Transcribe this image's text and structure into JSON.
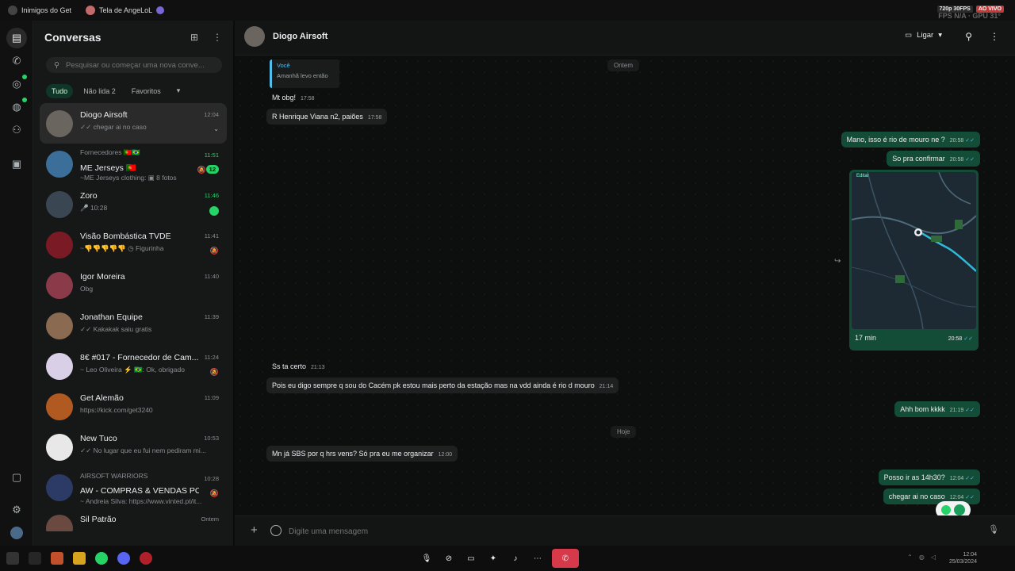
{
  "topbar": {
    "stream1": "Inimigos do Get",
    "stream2": "Tela de AngeLoL",
    "quality": "720p 30FPS",
    "live": "AO VIVO",
    "fps": "FPS N/A · GPU 31°"
  },
  "sidebar": {
    "title": "Conversas",
    "search_placeholder": "Pesquisar ou começar uma nova conve...",
    "filters": {
      "all": "Tudo",
      "unread": "Não lida",
      "unread_count": "2",
      "favorites": "Favoritos"
    },
    "chats": [
      {
        "name": "Diogo Airsoft",
        "preview": "✓✓ chegar ai no caso",
        "time": "12:04",
        "color": "#6b6560"
      },
      {
        "group": "Fornecedores 🇵🇹🇧🇷",
        "name": "ME Jerseys 🇵🇹",
        "preview": "~ME Jerseys clothing: ▣ 8 fotos",
        "time": "11:51",
        "unread": "12",
        "color": "#3c6e9a"
      },
      {
        "name": "Zoro",
        "preview": "🎤 10:28",
        "time": "11:46",
        "color": "#3a4752"
      },
      {
        "name": "Visão Bombástica TVDE",
        "preview": "~👎👎👎👎👎 ◷ Figurinha",
        "time": "11:41",
        "color": "#7a1a24"
      },
      {
        "name": "Igor Moreira",
        "preview": "Obg",
        "time": "11:40",
        "color": "#8a3a48"
      },
      {
        "name": "Jonathan Equipe",
        "preview": "✓✓ Kakakak saiu gratis",
        "time": "11:39",
        "color": "#8a6a50"
      },
      {
        "name": "8€ #017 - Fornecedor de Cam...",
        "preview": "~ Leo Oliveira ⚡ 🇧🇷: Ok, obrigado",
        "time": "11:24",
        "color": "#d9d0e8"
      },
      {
        "name": "Get Alemão",
        "preview": "https://kick.com/get3240",
        "time": "11:09",
        "color": "#b05a22"
      },
      {
        "name": "New Tuco",
        "preview": "✓✓ No lugar que eu fui nem pediram mi...",
        "time": "10:53",
        "color": "#e8e8e8"
      },
      {
        "group": "AIRSOFT WARRIORS",
        "name": "AW - COMPRAS & VENDAS PO...",
        "preview": "~ Andreia Silva: https://www.vinted.pt/it...",
        "time": "10:28",
        "color": "#2c3a66"
      },
      {
        "name": "Sil Patrão",
        "preview": "",
        "time": "Ontem",
        "color": "#6a4a40"
      }
    ]
  },
  "conversation": {
    "name": "Diogo Airsoft",
    "call_label": "Ligar",
    "quote_author": "Você",
    "quote_text": "Amanhã levo então",
    "day1": "Ontem",
    "day2": "Hoje",
    "messages": [
      {
        "text": "Mt obg!",
        "time": "17:58"
      },
      {
        "text": "R Henrique Viana n2, paiões",
        "time": "17:58"
      },
      {
        "text": "Mano, isso é rio de mouro ne ?",
        "time": "20:58"
      },
      {
        "text": "So pra confirmar",
        "time": "20:58"
      },
      {
        "text": "Ss ta certo",
        "time": "21:13"
      },
      {
        "text": "Pois eu digo sempre q sou do Cacém pk estou mais perto da estação mas na vdd ainda é rio d mouro",
        "time": "21:14"
      },
      {
        "text": "Ahh bom kkkk",
        "time": "21:19"
      },
      {
        "text": "Mn já SBS por q hrs vens? Só pra eu me  organizar",
        "time": "12:00"
      },
      {
        "text": "Posso ir as 14h30?",
        "time": "12:04"
      },
      {
        "text": "chegar ai no caso",
        "time": "12:04"
      }
    ],
    "map": {
      "duration": "17 min",
      "time": "20:58",
      "edit": "Editar"
    },
    "composer_placeholder": "Digite uma mensagem"
  },
  "taskbar": {
    "time": "12:04",
    "date": "25/03/2024"
  },
  "colors": {
    "accent": "#25d366",
    "outgoing": "#144d37",
    "incoming": "#1f2020",
    "end_call": "#d63a4a"
  }
}
